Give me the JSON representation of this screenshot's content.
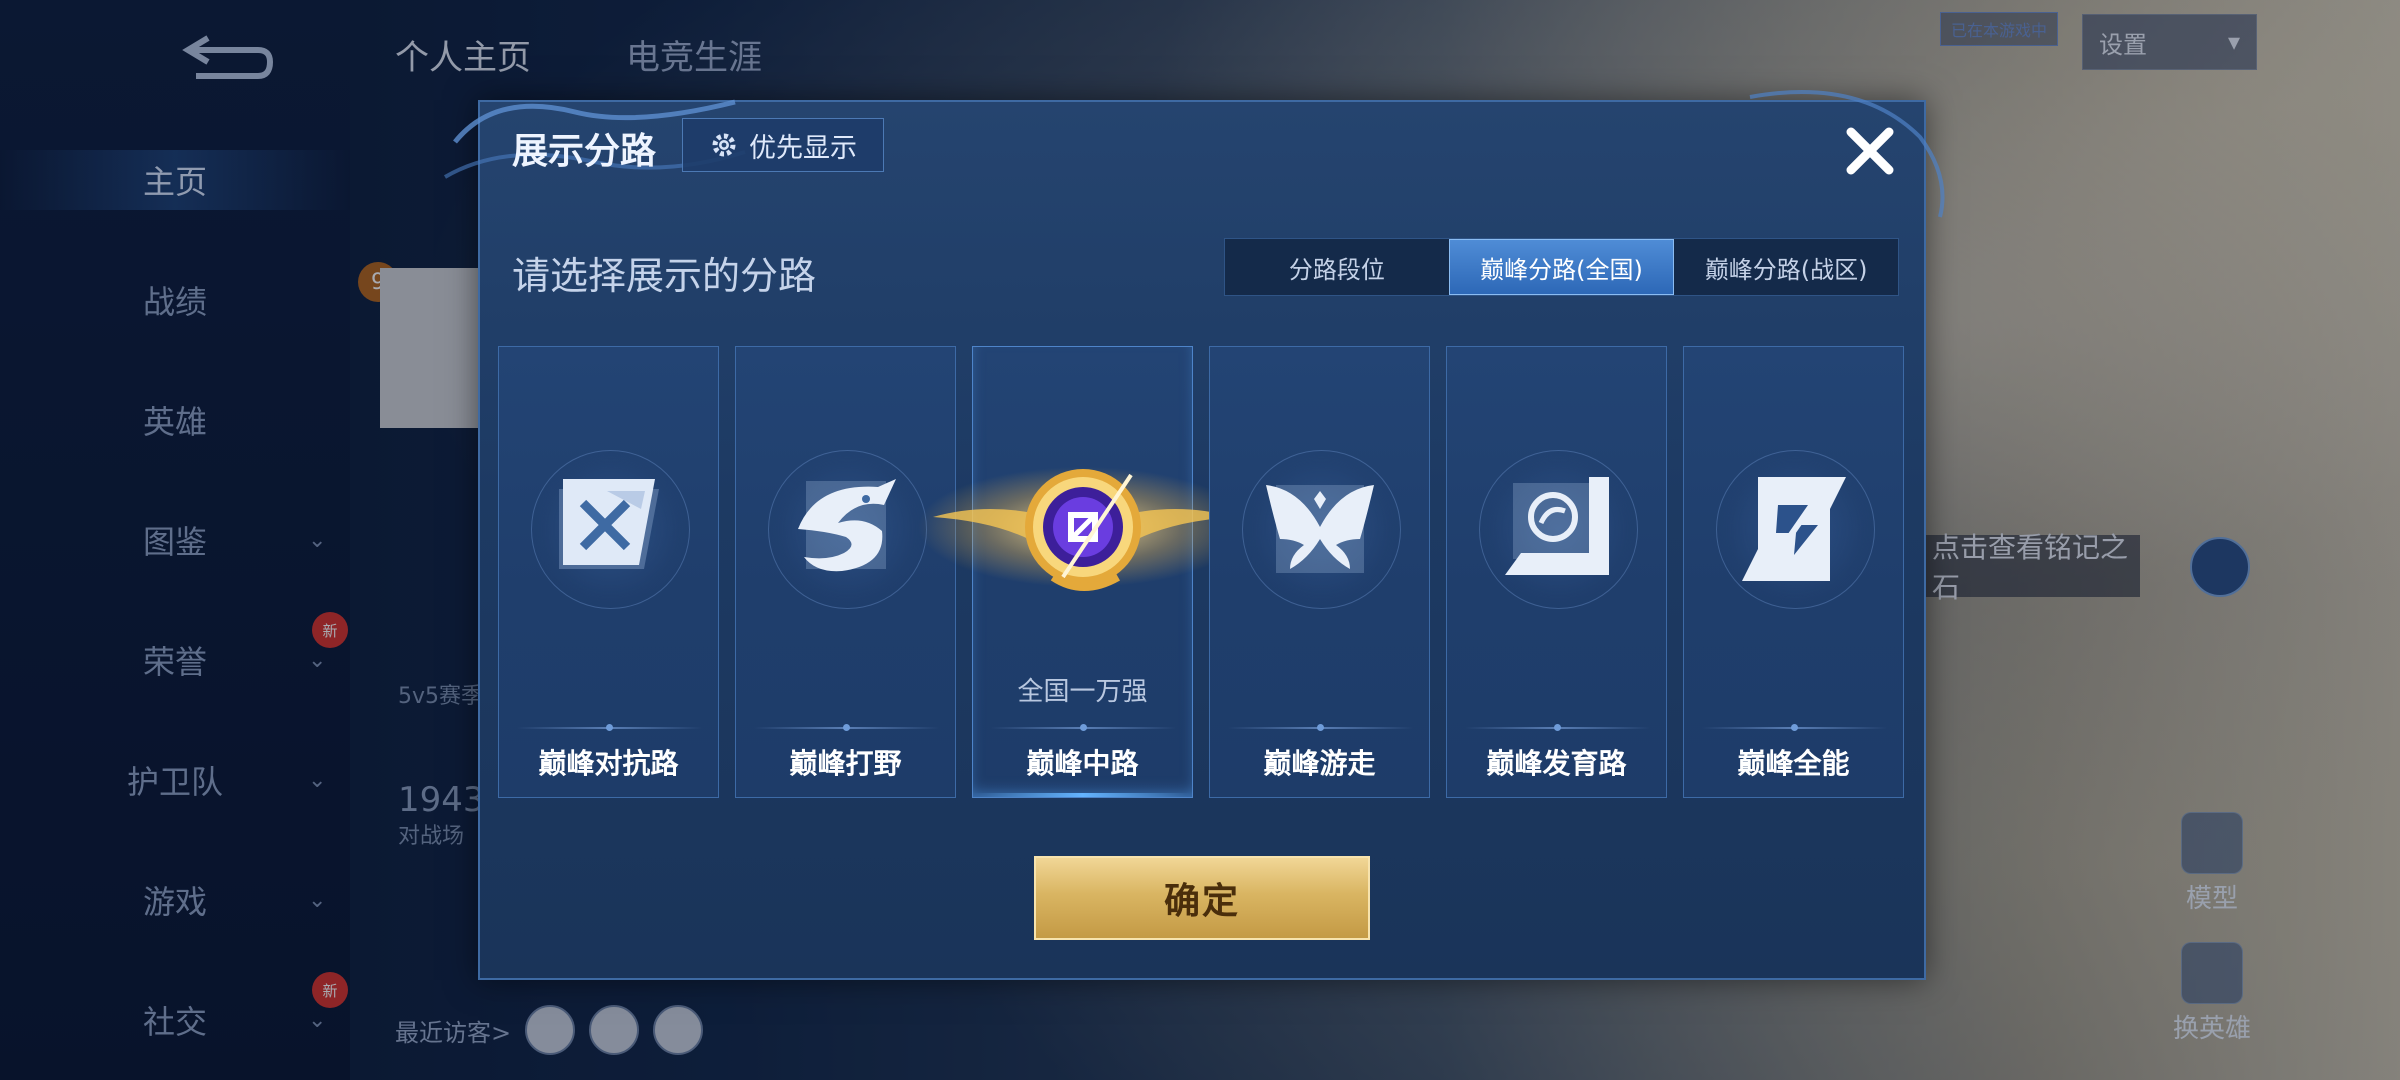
{
  "left_nav": {
    "items": [
      {
        "label": "主页",
        "active": true,
        "chevron": false,
        "new": false
      },
      {
        "label": "战绩",
        "active": false,
        "chevron": false,
        "new": false
      },
      {
        "label": "英雄",
        "active": false,
        "chevron": false,
        "new": false
      },
      {
        "label": "图鉴",
        "active": false,
        "chevron": true,
        "new": false
      },
      {
        "label": "荣誉",
        "active": false,
        "chevron": true,
        "new": true
      },
      {
        "label": "护卫队",
        "active": false,
        "chevron": true,
        "new": false
      },
      {
        "label": "游戏",
        "active": false,
        "chevron": true,
        "new": false
      },
      {
        "label": "社交",
        "active": false,
        "chevron": true,
        "new": true
      }
    ],
    "new_badge_text": "新"
  },
  "header": {
    "tabs": [
      "个人主页",
      "电竞生涯"
    ],
    "chip": "已在本游戏中",
    "select_value": "设置"
  },
  "background": {
    "level": "9",
    "mode_text": "5v5赛季",
    "number": "1943",
    "number_sub": "对战场",
    "visitors_label": "最近访客>",
    "tip": "点击查看铭记之石",
    "side_buttons": [
      "模型",
      "换英雄"
    ]
  },
  "modal": {
    "title": "展示分路",
    "priority_label": "优先显示",
    "subtitle": "请选择展示的分路",
    "segments": [
      {
        "label": "分路段位",
        "active": false
      },
      {
        "label": "巅峰分路(全国)",
        "active": true
      },
      {
        "label": "巅峰分路(战区)",
        "active": false
      }
    ],
    "cards": [
      {
        "label": "巅峰对抗路",
        "icon": "clash-lane-icon",
        "rank": "",
        "selected": false
      },
      {
        "label": "巅峰打野",
        "icon": "jungle-dragon-icon",
        "rank": "",
        "selected": false
      },
      {
        "label": "巅峰中路",
        "icon": "mid-lane-gold-emblem-icon",
        "rank": "全国一万强",
        "selected": true
      },
      {
        "label": "巅峰游走",
        "icon": "roam-wings-icon",
        "rank": "",
        "selected": false
      },
      {
        "label": "巅峰发育路",
        "icon": "farm-lane-icon",
        "rank": "",
        "selected": false
      },
      {
        "label": "巅峰全能",
        "icon": "all-round-icon",
        "rank": "",
        "selected": false
      }
    ],
    "confirm_label": "确定"
  },
  "colors": {
    "modal_bg": "#1f3c66",
    "accent_blue": "#3e7cc8",
    "confirm_gold": "#d9b562"
  }
}
